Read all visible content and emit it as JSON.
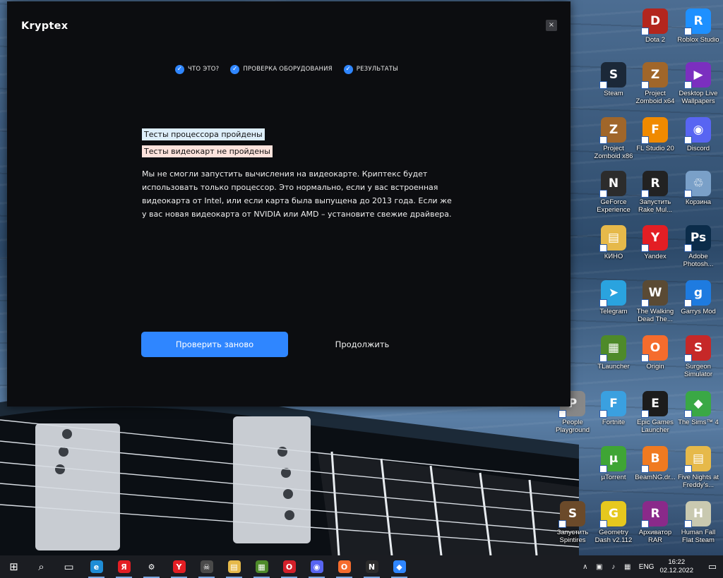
{
  "dialog": {
    "app_name": "Kryptex",
    "close_symbol": "×",
    "steps": [
      {
        "label": "ЧТО ЭТО?"
      },
      {
        "label": "ПРОВЕРКА ОБОРУДОВАНИЯ"
      },
      {
        "label": "РЕЗУЛЬТАТЫ"
      }
    ],
    "cpu_status": "Тесты процессора пройдены",
    "gpu_status": "Тесты видеокарт не пройдены",
    "message": "Мы не смогли запустить вычисления на видеокарте. Криптекс будет использовать только процессор. Это нормально, если у вас встроенная видеокарта от Intel, или если карта была выпущена до 2013 года. Если же у вас новая видеокарта от NVIDIA или AMD – установите свежие драйвера.",
    "retry_button": "Проверить заново",
    "continue_button": "Продолжить",
    "accent_color": "#2f86ff"
  },
  "desktop_icons": [
    {
      "label": "Dota 2",
      "glyph": "D",
      "color": "#b3261e",
      "icon": "dota2-icon"
    },
    {
      "label": "Roblox Studio",
      "glyph": "R",
      "color": "#1e90ff",
      "icon": "roblox-studio-icon"
    },
    {
      "label": "Steam",
      "glyph": "S",
      "color": "#1b2838",
      "icon": "steam-icon"
    },
    {
      "label": "Project Zomboid x64",
      "glyph": "Z",
      "color": "#a0662a",
      "icon": "project-zomboid-icon"
    },
    {
      "label": "Desktop Live Wallpapers",
      "glyph": "▶",
      "color": "#7b2fbf",
      "icon": "live-wallpapers-icon"
    },
    {
      "label": "Project Zomboid x86",
      "glyph": "Z",
      "color": "#a0662a",
      "icon": "project-zomboid-icon"
    },
    {
      "label": "FL Studio 20",
      "glyph": "F",
      "color": "#f08a00",
      "icon": "fl-studio-icon"
    },
    {
      "label": "Discord",
      "glyph": "◉",
      "color": "#5865f2",
      "icon": "discord-icon"
    },
    {
      "label": "GeForce Experience",
      "glyph": "N",
      "color": "#2c2c2c",
      "icon": "geforce-icon"
    },
    {
      "label": "Запустить Rake Mul...",
      "glyph": "R",
      "color": "#222222",
      "icon": "rake-icon"
    },
    {
      "label": "Корзина",
      "glyph": "♲",
      "color": "#7aa0c8",
      "icon": "recycle-bin-icon"
    },
    {
      "label": "КИНО",
      "glyph": "▤",
      "color": "#e6b94a",
      "icon": "folder-icon"
    },
    {
      "label": "Yandex",
      "glyph": "Y",
      "color": "#e31e24",
      "icon": "yandex-browser-icon"
    },
    {
      "label": "Adobe Photosh...",
      "glyph": "Ps",
      "color": "#0b2c4a",
      "icon": "photoshop-icon"
    },
    {
      "label": "Telegram",
      "glyph": "➤",
      "color": "#2aa3df",
      "icon": "telegram-icon"
    },
    {
      "label": "The Walking Dead The...",
      "glyph": "W",
      "color": "#5a4a34",
      "icon": "walking-dead-icon"
    },
    {
      "label": "Garrys Mod",
      "glyph": "g",
      "color": "#1e7be0",
      "icon": "garrys-mod-icon"
    },
    {
      "label": "TLauncher",
      "glyph": "▦",
      "color": "#4e8a2a",
      "icon": "tlauncher-icon"
    },
    {
      "label": "Origin",
      "glyph": "O",
      "color": "#f56c2d",
      "icon": "origin-icon"
    },
    {
      "label": "Surgeon Simulator",
      "glyph": "S",
      "color": "#c62828",
      "icon": "surgeon-simulator-icon"
    },
    {
      "label": "People Playground",
      "glyph": "P",
      "color": "#888888",
      "icon": "people-playground-icon"
    },
    {
      "label": "Fortnite",
      "glyph": "F",
      "color": "#3aa0e0",
      "icon": "fortnite-icon"
    },
    {
      "label": "Epic Games Launcher",
      "glyph": "E",
      "color": "#1c1c1c",
      "icon": "epic-games-icon"
    },
    {
      "label": "The Sims™ 4",
      "glyph": "◆",
      "color": "#3aa845",
      "icon": "sims4-icon"
    },
    {
      "label": "µTorrent",
      "glyph": "µ",
      "color": "#3fa535",
      "icon": "utorrent-icon"
    },
    {
      "label": "BeamNG.dr...",
      "glyph": "B",
      "color": "#f07a20",
      "icon": "beamng-icon"
    },
    {
      "label": "Five Nights at Freddy's...",
      "glyph": "▤",
      "color": "#e6b94a",
      "icon": "folder-icon"
    },
    {
      "label": "Запустить Spintires",
      "glyph": "S",
      "color": "#6b4a2a",
      "icon": "spintires-icon"
    },
    {
      "label": "Geometry Dash v2.112",
      "glyph": "G",
      "color": "#e6c81e",
      "icon": "geometry-dash-icon"
    },
    {
      "label": "Архиватор RAR",
      "glyph": "R",
      "color": "#8a2a8a",
      "icon": "winrar-icon"
    },
    {
      "label": "Human Fall Flat Steam",
      "glyph": "H",
      "color": "#c9c9b0",
      "icon": "human-fall-flat-icon"
    }
  ],
  "taskbar": {
    "items": [
      {
        "icon": "windows-start-icon",
        "glyph": "⊞",
        "color": "#1b1d22"
      },
      {
        "icon": "search-icon",
        "glyph": "⌕",
        "color": "#1b1d22"
      },
      {
        "icon": "task-view-icon",
        "glyph": "▭",
        "color": "#1b1d22"
      },
      {
        "icon": "edge-icon",
        "glyph": "e",
        "color": "#1f8dd6"
      },
      {
        "icon": "yandex-icon",
        "glyph": "Я",
        "color": "#e31e24"
      },
      {
        "icon": "settings-gear-icon",
        "glyph": "⚙",
        "color": "#1b1d22"
      },
      {
        "icon": "yandex-browser-icon",
        "glyph": "Y",
        "color": "#e31e24"
      },
      {
        "icon": "game-icon",
        "glyph": "☠",
        "color": "#4a4a4a"
      },
      {
        "icon": "file-explorer-icon",
        "glyph": "▤",
        "color": "#e6b94a"
      },
      {
        "icon": "minecraft-icon",
        "glyph": "▦",
        "color": "#4e8a2a"
      },
      {
        "icon": "opera-icon",
        "glyph": "O",
        "color": "#d3202a"
      },
      {
        "icon": "discord-icon",
        "glyph": "◉",
        "color": "#5865f2"
      },
      {
        "icon": "origin-icon",
        "glyph": "O",
        "color": "#f56c2d"
      },
      {
        "icon": "geforce-icon",
        "glyph": "N",
        "color": "#2c2c2c"
      },
      {
        "icon": "kryptex-icon",
        "glyph": "◆",
        "color": "#2f86ff"
      }
    ],
    "language": "ENG",
    "time": "16:22",
    "date": "02.12.2022"
  }
}
